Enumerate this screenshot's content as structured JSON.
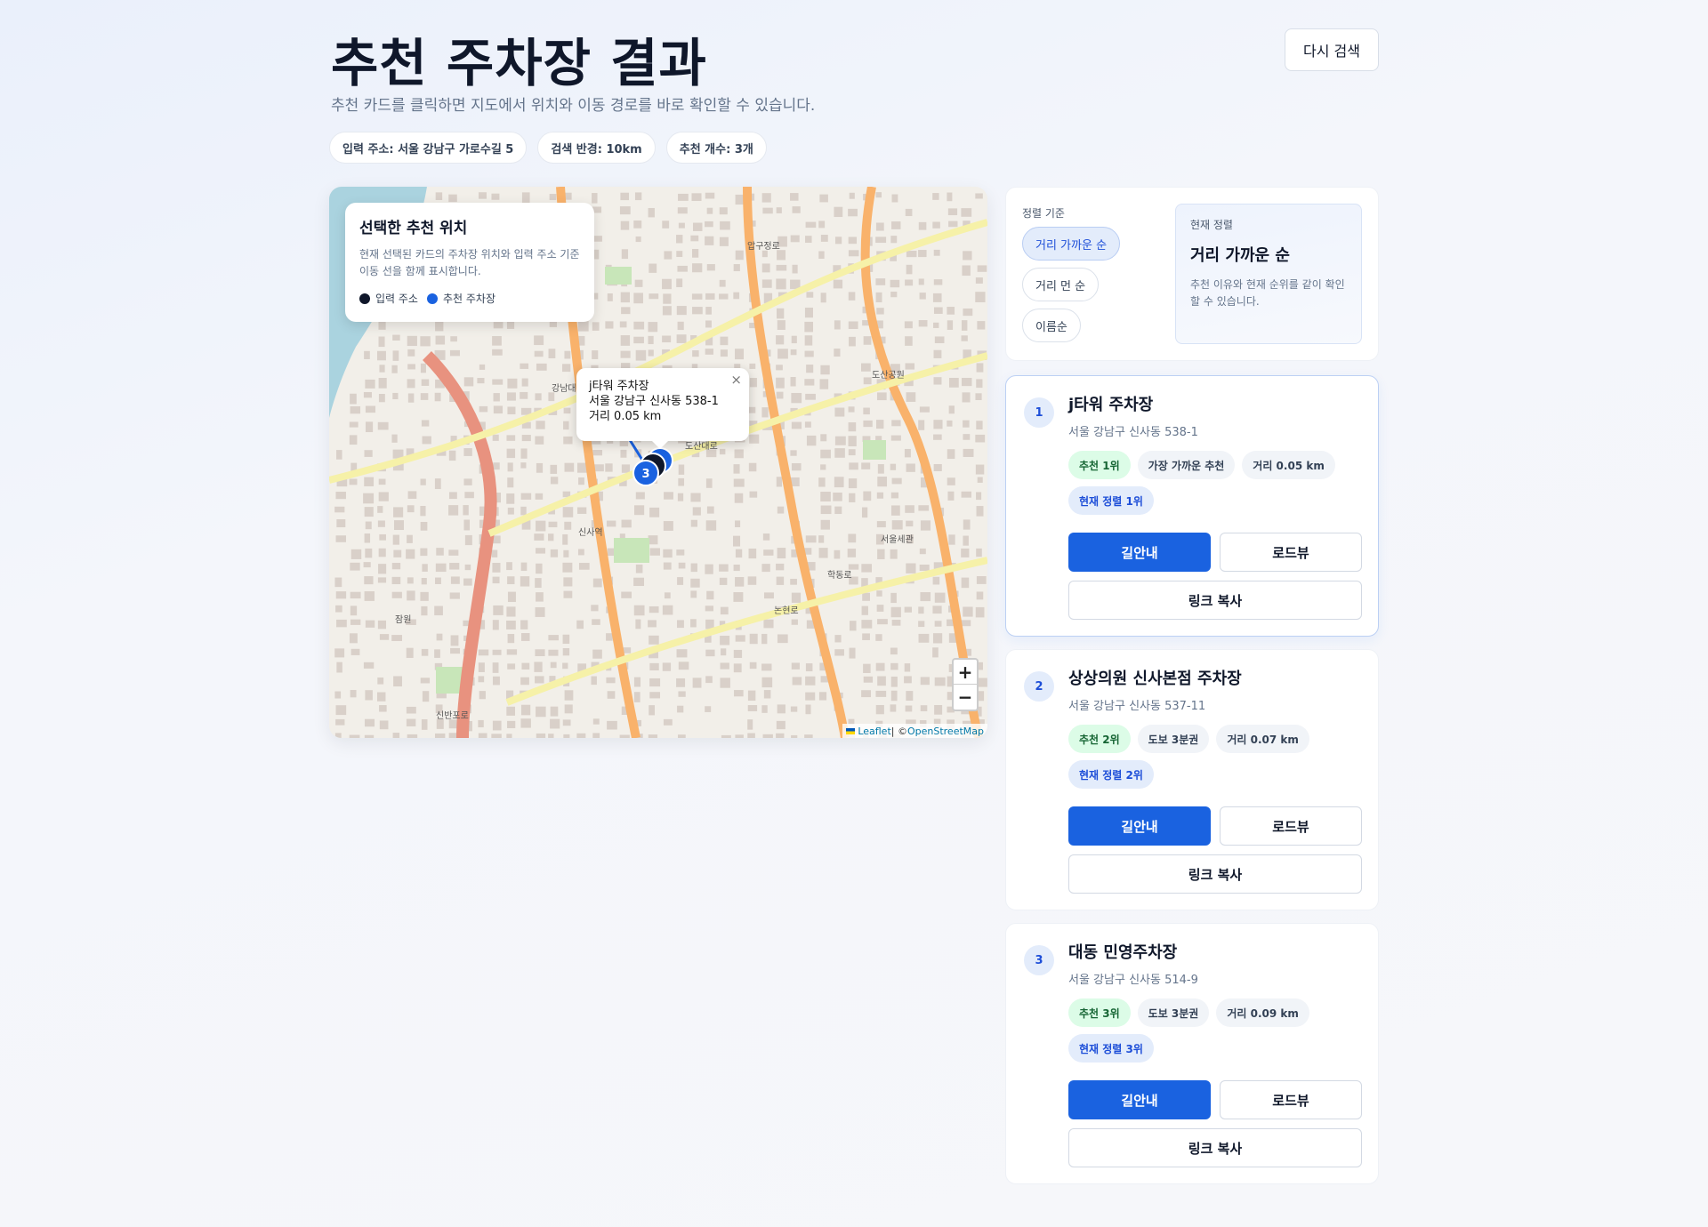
{
  "header": {
    "title": "추천 주차장 결과",
    "subtitle": "추천 카드를 클릭하면 지도에서 위치와 이동 경로를 바로 확인할 수 있습니다.",
    "research_button": "다시 검색"
  },
  "chips": [
    "입력 주소: 서울 강남구 가로수길 5",
    "검색 반경: 10km",
    "추천 개수: 3개"
  ],
  "map": {
    "legend": {
      "title": "선택한 추천 위치",
      "desc": "현재 선택된 카드의 주차장 위치와 입력 주소 기준 이동 선을 함께 표시합니다.",
      "input_label": "입력 주소",
      "rec_label": "추천 주차장"
    },
    "popup": {
      "name": "j타워 주차장",
      "address": "서울 강남구 신사동 538-1",
      "distance": "거리 0.05 km",
      "close": "×"
    },
    "marker_label": "3",
    "zoom_in": "+",
    "zoom_out": "−",
    "attribution_leaflet": "Leaflet",
    "attribution_sep": " | © ",
    "attribution_osm": "OpenStreetMap",
    "place_labels": [
      "신사역",
      "도산대로",
      "압구정로",
      "논현로",
      "학동로",
      "강남대로",
      "도산공원",
      "서울세관",
      "잠원",
      "신반포로"
    ],
    "colors": {
      "land": "#f2efe9",
      "water": "#aad3df",
      "block": "#d9d0c9",
      "park": "#c8e6b9",
      "major_road": "#f9b26b",
      "secondary_road": "#f6f1a8",
      "motorway": "#e8927f"
    }
  },
  "sort": {
    "label": "정렬 기준",
    "options": [
      "거리 가까운 순",
      "거리 먼 순",
      "이름순"
    ],
    "active_index": 0,
    "current_label": "현재 정렬",
    "current_value": "거리 가까운 순",
    "current_desc": "추천 이유와 현재 순위를 같이 확인할 수 있습니다."
  },
  "results": [
    {
      "rank": "1",
      "name": "j타워 주차장",
      "address": "서울 강남구 신사동 538-1",
      "tags": [
        "추천 1위",
        "가장 가까운 추천",
        "거리 0.05 km",
        "현재 정렬 1위"
      ],
      "nav": "길안내",
      "roadview": "로드뷰",
      "copy": "링크 복사"
    },
    {
      "rank": "2",
      "name": "상상의원 신사본점 주차장",
      "address": "서울 강남구 신사동 537-11",
      "tags": [
        "추천 2위",
        "도보 3분권",
        "거리 0.07 km",
        "현재 정렬 2위"
      ],
      "nav": "길안내",
      "roadview": "로드뷰",
      "copy": "링크 복사"
    },
    {
      "rank": "3",
      "name": "대동 민영주차장",
      "address": "서울 강남구 신사동 514-9",
      "tags": [
        "추천 3위",
        "도보 3분권",
        "거리 0.09 km",
        "현재 정렬 3위"
      ],
      "nav": "길안내",
      "roadview": "로드뷰",
      "copy": "링크 복사"
    }
  ]
}
